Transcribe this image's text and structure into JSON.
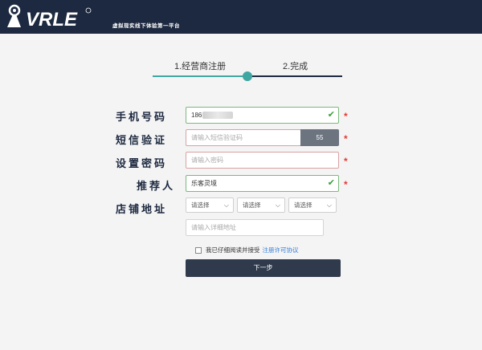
{
  "header": {
    "brand": "VRLE",
    "tagline": "虚拟现实线下体验第一平台",
    "bg_color": "#1d2940"
  },
  "steps": {
    "step1": "1.经营商注册",
    "step2": "2.完成",
    "progress_color": "#3ea7a1"
  },
  "form": {
    "phone": {
      "label": "手机号码",
      "value": "186",
      "state": "valid"
    },
    "sms": {
      "label": "短信验证",
      "placeholder": "请输入短信验证码",
      "button": "55"
    },
    "password": {
      "label": "设置密码",
      "placeholder": "请输入密码"
    },
    "referrer": {
      "label": "推荐人",
      "value": "乐客灵境",
      "state": "valid"
    },
    "address": {
      "label": "店铺地址",
      "select1": "请选择",
      "select2": "请选择",
      "select3": "请选择",
      "detail_placeholder": "请输入详细地址"
    },
    "required_mark": "*",
    "agree_text": "我已仔细阅读并接受",
    "agree_link": "注册许可协议",
    "submit": "下一步"
  }
}
